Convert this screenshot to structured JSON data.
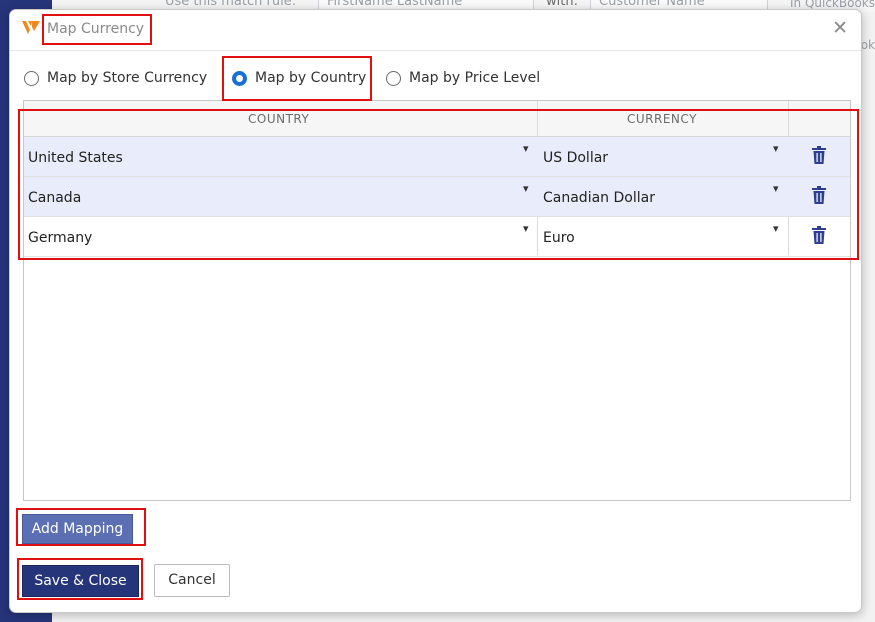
{
  "background": {
    "match_rule_label": "Use this match rule:",
    "match_rule_value": "FirstName LastName",
    "with_label": "with:",
    "with_value": "Customer Name",
    "right_text": "In QuickBooks",
    "right_text2": "ok"
  },
  "dialog": {
    "title": "Map Currency",
    "close_glyph": "✕"
  },
  "radio": {
    "options": [
      {
        "label": "Map by Store Currency",
        "selected": false
      },
      {
        "label": "Map by Country",
        "selected": true
      },
      {
        "label": "Map by Price Level",
        "selected": false
      }
    ]
  },
  "grid": {
    "headers": {
      "country": "COUNTRY",
      "currency": "CURRENCY"
    },
    "rows": [
      {
        "country": "United States",
        "currency": "US Dollar"
      },
      {
        "country": "Canada",
        "currency": "Canadian Dollar"
      },
      {
        "country": "Germany",
        "currency": "Euro"
      }
    ],
    "dropdown_glyph": "▾"
  },
  "buttons": {
    "add_mapping": "Add Mapping",
    "save_close": "Save & Close",
    "cancel": "Cancel"
  },
  "colors": {
    "accent": "#26347a",
    "radio_selected": "#1b6ed6",
    "row_highlight": "#e8ecfb",
    "annotation": "#e01010"
  }
}
